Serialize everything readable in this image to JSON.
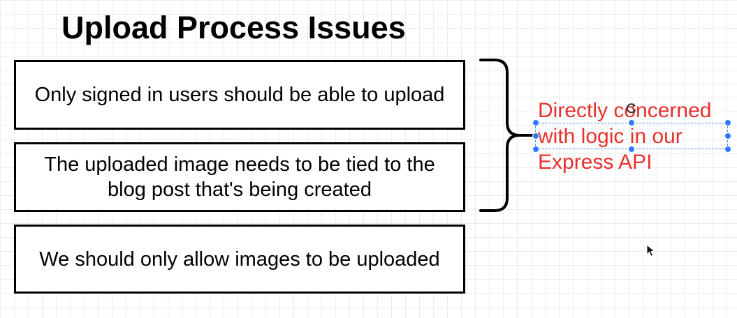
{
  "title": "Upload Process Issues",
  "boxes": [
    {
      "text": "Only signed in users should be able to upload"
    },
    {
      "text": "The uploaded image needs to be tied to the blog post that's being created"
    },
    {
      "text": "We should only allow images to be uploaded"
    }
  ],
  "note": {
    "lines": [
      "Directly concerned",
      "with logic in our",
      "Express API"
    ],
    "color": "#e8302c"
  },
  "icons": {
    "rotate": "rotate-icon",
    "cursor": "mouse-cursor-icon"
  }
}
